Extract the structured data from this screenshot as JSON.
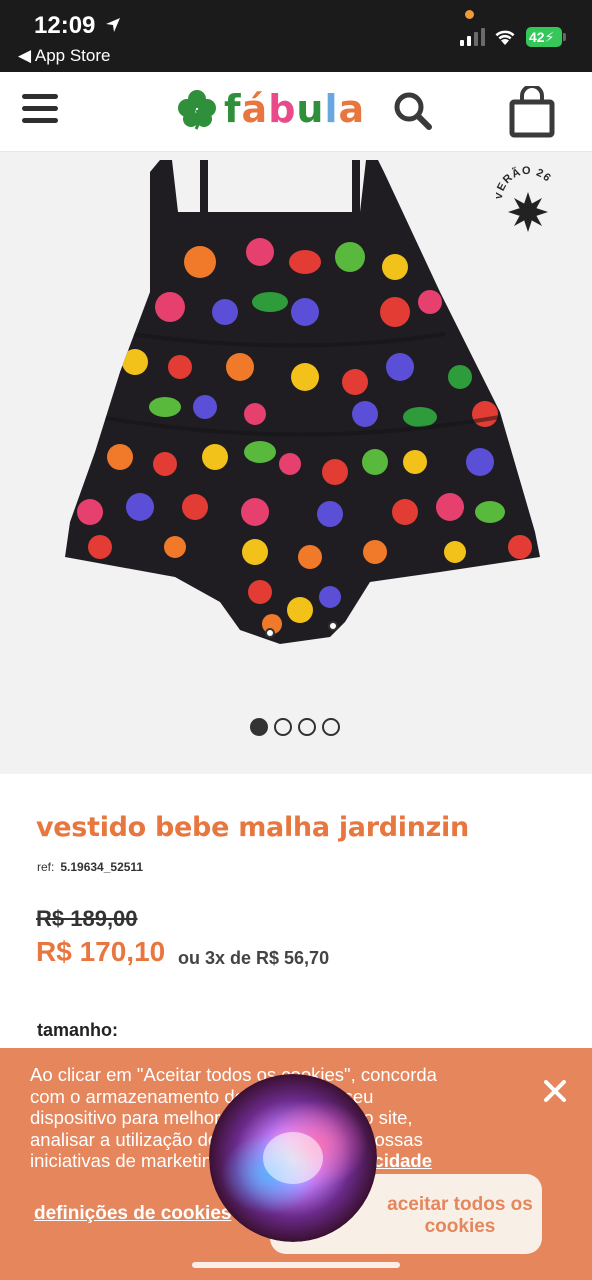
{
  "status_bar": {
    "time": "12:09",
    "back_label": "◀ App Store",
    "battery": "42"
  },
  "header": {
    "logo_text": "fábula",
    "logo_letter_colors": [
      "#2f8f3a",
      "#e8763f",
      "#e84a8a",
      "#2f8f3a",
      "#6aa6e0",
      "#e8763f"
    ]
  },
  "gallery": {
    "badge_text": "VERÃO 26",
    "dots": [
      true,
      false,
      false,
      false
    ]
  },
  "product": {
    "title": "vestido bebe malha jardinzin",
    "ref_label": "ref:",
    "ref_value": "5.19634_52511",
    "old_price": "R$ 189,00",
    "price": "R$ 170,10",
    "installments": "ou 3x de R$ 56,70",
    "size_label": "tamanho:"
  },
  "cookies": {
    "lines": [
      "Ao clicar em \"Aceitar todos os cookies\", concorda",
      "com o armazenamento de cookies no seu",
      "dispositivo para melhorar a navegação no site,",
      "analisar a utilização do site e ajudar nas nossas",
      "iniciativas de marketing."
    ],
    "policy_link": "política de privacidade",
    "settings_label": "definições de cookies",
    "accept_label": "aceitar todos os cookies"
  },
  "colors": {
    "accent": "#e8763f",
    "banner": "#e5865d",
    "banner_button": "#f8f0e6"
  }
}
